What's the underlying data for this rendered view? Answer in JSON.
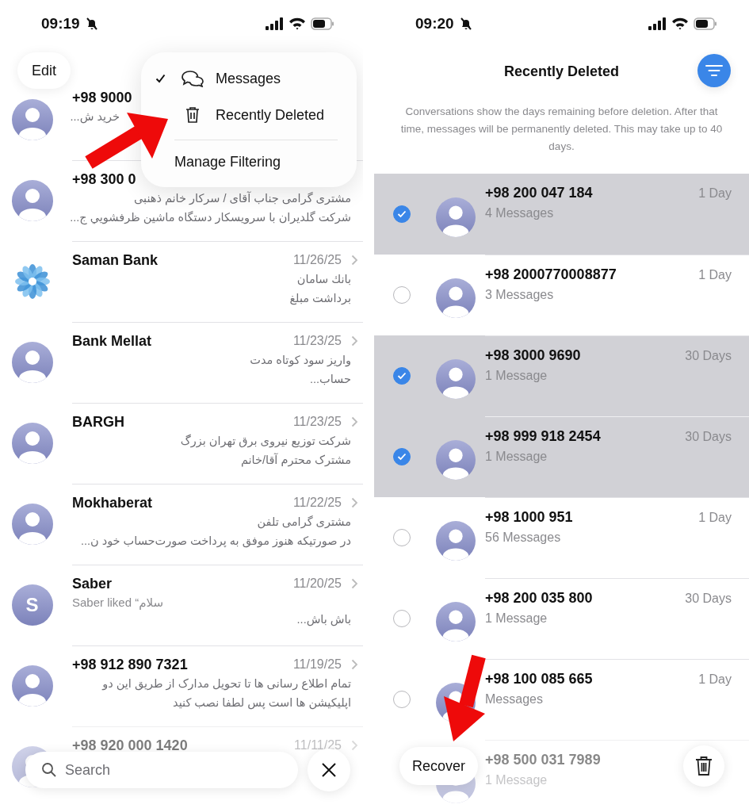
{
  "left_screen": {
    "status_bar": {
      "time": "09:19"
    },
    "edit_button": "Edit",
    "menu": [
      {
        "label": "Messages",
        "kind": "filter",
        "checked": true
      },
      {
        "label": "Recently Deleted",
        "kind": "filter",
        "checked": false
      },
      {
        "label": "Manage Filtering",
        "kind": "action"
      }
    ],
    "conversations": [
      {
        "kind": "clipped",
        "avatar": {
          "kind": "person"
        },
        "name": "+98 9000",
        "lines": [
          "خرید ش..."
        ],
        "faded": false
      },
      {
        "kind": "message",
        "avatar": {
          "kind": "person"
        },
        "name": "+98 300 0",
        "lines": [
          "مشتری گرامی جناب آقای / سرکار خانم ذهنبی",
          "شرکت گلدیران با سرویسکار دستگاه ماشین ظرفشویي ج..."
        ],
        "faded": false
      },
      {
        "kind": "message",
        "avatar": {
          "kind": "logo"
        },
        "name": "Saman Bank",
        "date": "11/26/25",
        "lines": [
          "بانك سامان",
          "برداشت مبلغ"
        ],
        "faded": false
      },
      {
        "kind": "message",
        "avatar": {
          "kind": "person"
        },
        "name": "Bank Mellat",
        "date": "11/23/25",
        "lines": [
          "واریز سود کوتاه مدت",
          "حساب..."
        ],
        "faded": false
      },
      {
        "kind": "message",
        "avatar": {
          "kind": "person"
        },
        "name": "BARGH",
        "date": "11/23/25",
        "lines": [
          "شرکت توزیع نیروی برق تهران بزرگ",
          "مشترک محترم آقا/خانم"
        ],
        "faded": false
      },
      {
        "kind": "message",
        "avatar": {
          "kind": "person"
        },
        "name": "Mokhaberat",
        "date": "11/22/25",
        "lines": [
          "مشتری گرامی تلفن",
          "در صورتیکه هنوز موفق به پرداخت صورت‌حساب خود ن..."
        ],
        "faded": false
      },
      {
        "kind": "message",
        "avatar": {
          "kind": "initial",
          "text": "S"
        },
        "name": "Saber",
        "date": "11/20/25",
        "reaction": "Saber liked “سلام",
        "lines": [
          "باش باش..."
        ],
        "faded": false
      },
      {
        "kind": "message",
        "avatar": {
          "kind": "person"
        },
        "name": "+98 912 890 7321",
        "date": "11/19/25",
        "lines": [
          "تمام اطلاع رسانی ها تا تحویل مدارک از طریق این دو",
          "اپلیکیشن ها است پس لطفا نصب کنید"
        ],
        "faded": false
      },
      {
        "kind": "message",
        "avatar": {
          "kind": "person"
        },
        "name": "+98 920 000 1420",
        "date": "11/11/25",
        "faded": true
      }
    ],
    "search": {
      "placeholder": "Search"
    }
  },
  "right_screen": {
    "status_bar": {
      "time": "09:20"
    },
    "title": "Recently Deleted",
    "note": "Conversations show the days remaining before deletion. After that time, messages will be permanently deleted. This may take up to 40 days.",
    "conversations": [
      {
        "name": "+98 200 047 184",
        "count": "4 Messages",
        "days": "1 Day",
        "selected": true,
        "faded": false
      },
      {
        "name": "+98 2000770008877",
        "count": "3 Messages",
        "days": "1 Day",
        "selected": false,
        "faded": false
      },
      {
        "name": "+98 3000 9690",
        "count": "1 Message",
        "days": "30 Days",
        "selected": true,
        "faded": false
      },
      {
        "name": "+98 999 918 2454",
        "count": "1 Message",
        "days": "30 Days",
        "selected": true,
        "faded": false
      },
      {
        "name": "+98 1000 951",
        "count": "56 Messages",
        "days": "1 Day",
        "selected": false,
        "faded": false
      },
      {
        "name": "+98 200 035 800",
        "count": "1 Message",
        "days": "30 Days",
        "selected": false,
        "faded": false
      },
      {
        "name": "+98 100 085 665",
        "count": "Messages",
        "days": "1 Day",
        "selected": false,
        "faded": false
      },
      {
        "name": "+98 500 031 7989",
        "count": "1 Message",
        "selected": false,
        "faded": true
      }
    ],
    "recover_button": "Recover"
  }
}
